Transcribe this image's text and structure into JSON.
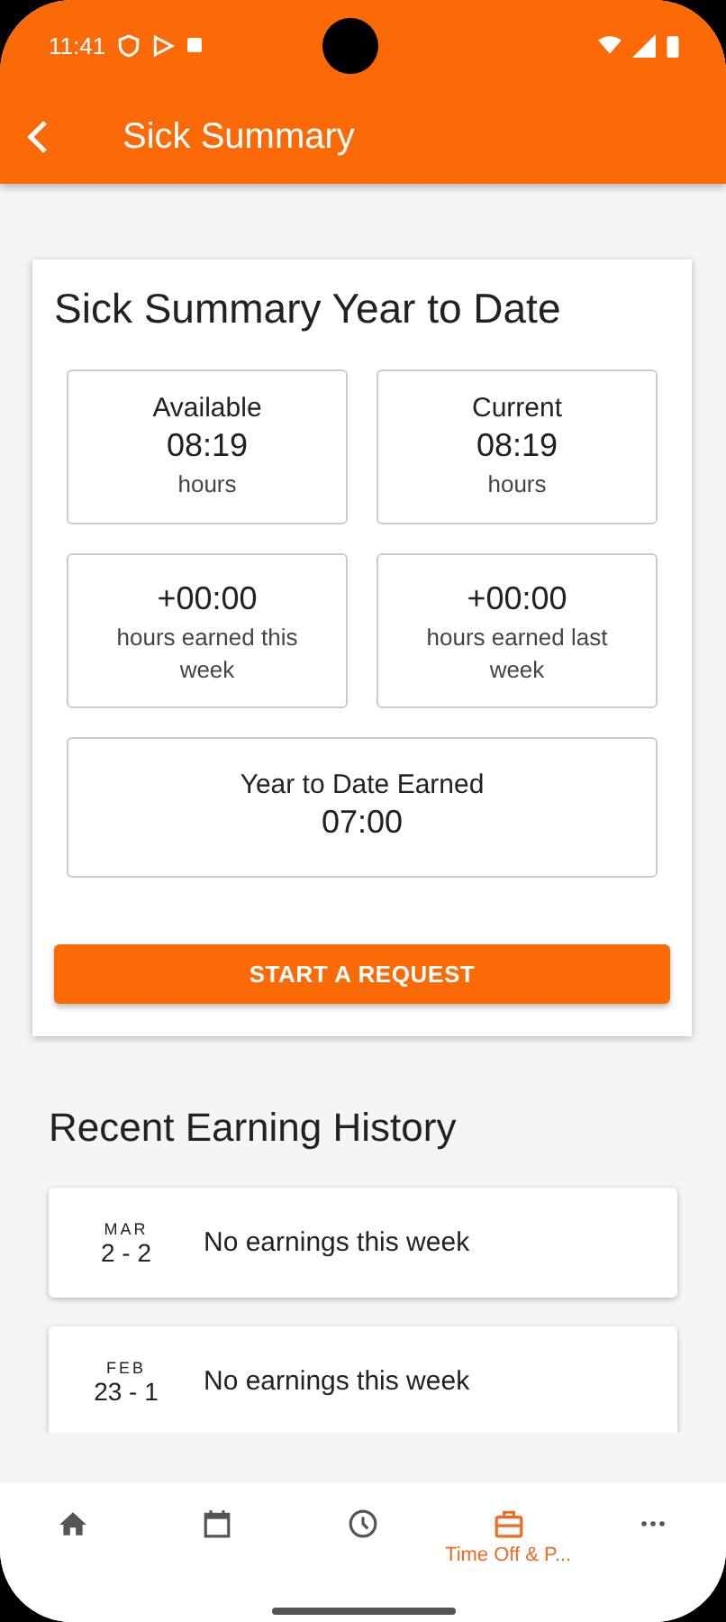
{
  "status_bar": {
    "time": "11:41"
  },
  "app_bar": {
    "title": "Sick Summary"
  },
  "summary": {
    "title": "Sick Summary Year to Date",
    "tiles": [
      {
        "kind": "split",
        "label": "Available",
        "value": "08:19",
        "unit": "hours"
      },
      {
        "kind": "split",
        "label": "Current",
        "value": "08:19",
        "unit": "hours"
      },
      {
        "kind": "split",
        "value": "+00:00",
        "unit": "hours earned this week"
      },
      {
        "kind": "split",
        "value": "+00:00",
        "unit": "hours earned last week"
      },
      {
        "kind": "wide",
        "label": "Year to Date Earned",
        "value": "07:00"
      }
    ],
    "button": "START A REQUEST"
  },
  "history": {
    "title": "Recent Earning History",
    "rows": [
      {
        "month": "MAR",
        "days": "2 - 2",
        "text": "No earnings this week"
      },
      {
        "month": "FEB",
        "days": "23 - 1",
        "text": "No earnings this week"
      }
    ]
  },
  "bottom_nav": [
    {
      "kind": "home",
      "selected": false
    },
    {
      "kind": "calendar",
      "selected": false
    },
    {
      "kind": "clock",
      "selected": false
    },
    {
      "kind": "briefcase",
      "selected": true,
      "label": "Time Off & P..."
    },
    {
      "kind": "more",
      "selected": false
    }
  ]
}
